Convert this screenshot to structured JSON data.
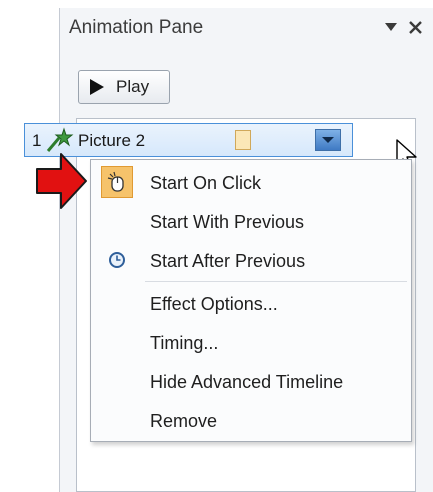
{
  "pane": {
    "title": "Animation Pane",
    "play_label": "Play"
  },
  "item": {
    "number": "1",
    "name": "Picture 2"
  },
  "menu": {
    "items": [
      {
        "label": "Start On Click",
        "icon": "mouse-click-icon",
        "selected": true
      },
      {
        "label": "Start With Previous",
        "icon": null
      },
      {
        "label": "Start After Previous",
        "icon": "clock-icon"
      },
      {
        "label": "Effect Options..."
      },
      {
        "label": "Timing..."
      },
      {
        "label": "Hide Advanced Timeline"
      },
      {
        "label": "Remove"
      }
    ]
  },
  "colors": {
    "selected_icon_bg": "#f6c36b",
    "annotation_arrow": "#e11111",
    "item_highlight": "#d6e8fb"
  }
}
